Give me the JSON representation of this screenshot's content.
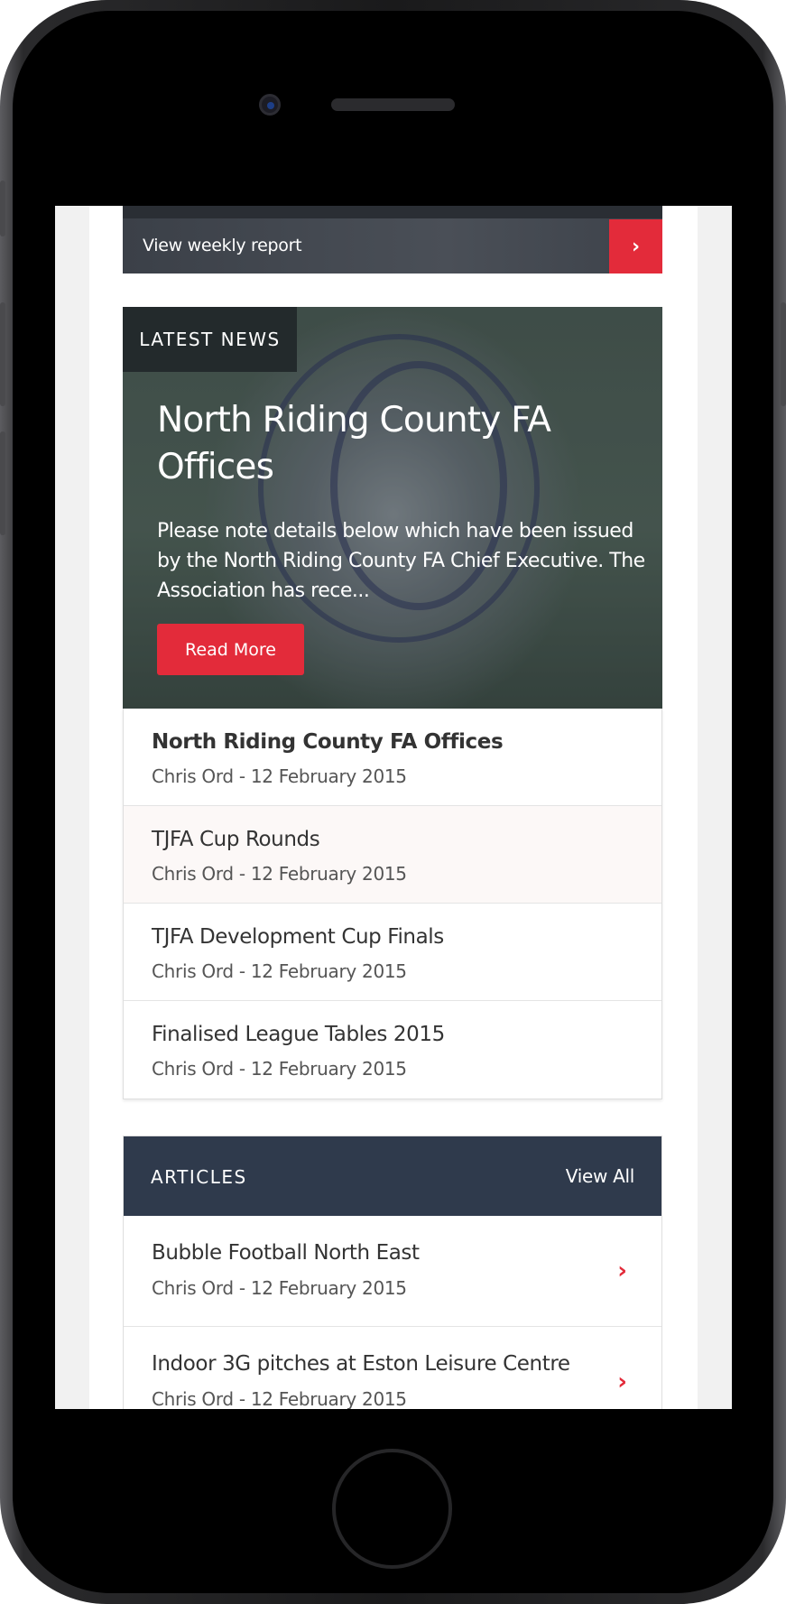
{
  "weekly": {
    "label": "View weekly report",
    "arrow": "›"
  },
  "hero": {
    "tag": "LATEST NEWS",
    "title": "North Riding County FA Offices",
    "excerpt": "Please note details below which have been issued by the North Riding County FA Chief Executive. The Association has rece...",
    "button": "Read More"
  },
  "news": [
    {
      "title": "North Riding County FA Offices",
      "meta": "Chris Ord - 12 February 2015"
    },
    {
      "title": "TJFA Cup Rounds",
      "meta": "Chris Ord - 12 February 2015"
    },
    {
      "title": "TJFA Development Cup Finals",
      "meta": "Chris Ord - 12 February 2015"
    },
    {
      "title": "Finalised League Tables 2015",
      "meta": "Chris Ord - 12 February 2015"
    }
  ],
  "articles": {
    "title": "ARTICLES",
    "view_all": "View All",
    "items": [
      {
        "title": "Bubble Football North East",
        "meta": "Chris Ord - 12 February 2015"
      },
      {
        "title": "Indoor 3G pitches at Eston Leisure Centre",
        "meta": "Chris Ord - 12 February 2015"
      }
    ]
  },
  "colors": {
    "accent": "#e32b3a",
    "header": "#2f3a4c",
    "tag_bg": "#232a2c"
  },
  "icons": {
    "arrow": "chevron-right-icon"
  }
}
